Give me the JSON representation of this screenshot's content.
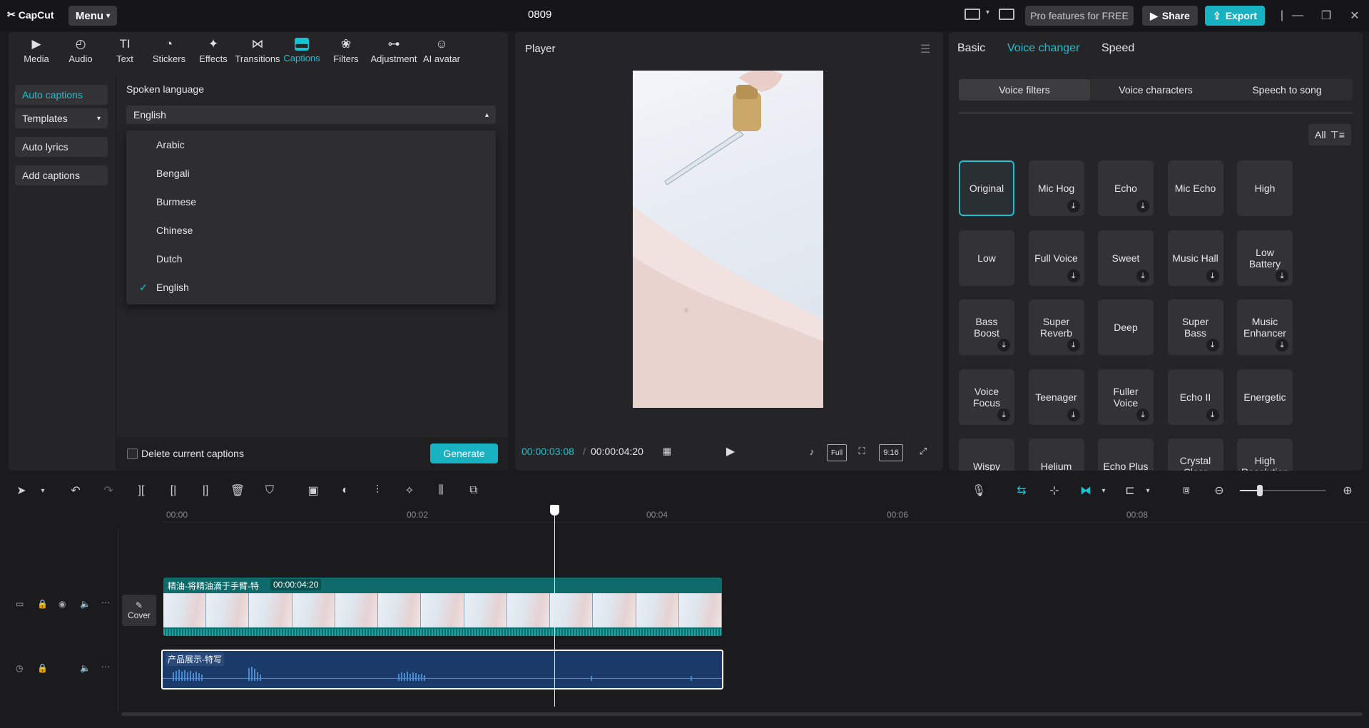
{
  "app": {
    "brand": "CapCut",
    "menu_label": "Menu",
    "project_title": "0809",
    "pro_label": "Pro features for FREE",
    "share_label": "Share",
    "export_label": "Export"
  },
  "toolbar": [
    {
      "label": "Media",
      "icon": "media-icon"
    },
    {
      "label": "Audio",
      "icon": "audio-icon"
    },
    {
      "label": "Text",
      "icon": "text-icon"
    },
    {
      "label": "Stickers",
      "icon": "sticker-icon"
    },
    {
      "label": "Effects",
      "icon": "effects-icon"
    },
    {
      "label": "Transitions",
      "icon": "transitions-icon"
    },
    {
      "label": "Captions",
      "icon": "captions-icon",
      "active": true
    },
    {
      "label": "Filters",
      "icon": "filters-icon"
    },
    {
      "label": "Adjustment",
      "icon": "adjustment-icon"
    },
    {
      "label": "AI avatar",
      "icon": "ai-avatar-icon"
    }
  ],
  "captions": {
    "nav": [
      {
        "label": "Auto captions",
        "active": true
      },
      {
        "label": "Templates"
      },
      {
        "label": "Auto lyrics"
      },
      {
        "label": "Add captions"
      }
    ],
    "spoken_language_label": "Spoken language",
    "selected_language": "English",
    "languages": [
      "Arabic",
      "Bengali",
      "Burmese",
      "Chinese",
      "Dutch",
      "English"
    ],
    "delete_label": "Delete current captions",
    "generate_label": "Generate"
  },
  "player": {
    "title": "Player",
    "current_time": "00:00:03:08",
    "separator": "/",
    "total_time": "00:00:04:20",
    "full_label": "Full",
    "ratio_label": "9:16"
  },
  "voice": {
    "tabs": [
      "Basic",
      "Voice changer",
      "Speed"
    ],
    "active_tab": "Voice changer",
    "segments": [
      "Voice filters",
      "Voice characters",
      "Speech to song"
    ],
    "active_segment": "Voice filters",
    "filter_label": "All",
    "filters": [
      {
        "label": "Original",
        "selected": true,
        "download": false
      },
      {
        "label": "Mic Hog",
        "download": true
      },
      {
        "label": "Echo",
        "download": true
      },
      {
        "label": "Mic Echo",
        "download": false
      },
      {
        "label": "High",
        "download": false
      },
      {
        "label": "Low",
        "download": false
      },
      {
        "label": "Full Voice",
        "download": true
      },
      {
        "label": "Sweet",
        "download": true
      },
      {
        "label": "Music Hall",
        "download": true
      },
      {
        "label": "Low Battery",
        "download": true
      },
      {
        "label": "Bass Boost",
        "download": true
      },
      {
        "label": "Super Reverb",
        "download": true
      },
      {
        "label": "Deep",
        "download": false
      },
      {
        "label": "Super Bass",
        "download": true
      },
      {
        "label": "Music Enhancer",
        "download": true
      },
      {
        "label": "Voice Focus",
        "download": true
      },
      {
        "label": "Teenager",
        "download": true
      },
      {
        "label": "Fuller Voice",
        "download": true
      },
      {
        "label": "Echo II",
        "download": true
      },
      {
        "label": "Energetic",
        "download": false
      },
      {
        "label": "Wispy",
        "download": false
      },
      {
        "label": "Helium",
        "download": false
      },
      {
        "label": "Echo Plus",
        "download": false
      },
      {
        "label": "Crystal Clear",
        "download": false
      },
      {
        "label": "High Resolution",
        "download": false
      }
    ]
  },
  "timeline": {
    "ruler": [
      "00:00",
      "00:02",
      "00:04",
      "00:06",
      "00:08"
    ],
    "cover_label": "Cover",
    "video_clip_label": "精油-将精油滴于手臂-特",
    "video_clip_duration": "00:00:04:20",
    "audio_clip_label": "产品展示-特写"
  },
  "colors": {
    "accent": "#17c2d4",
    "audio_clip": "#1a3a6a",
    "video_clip": "#0f6b6b"
  }
}
